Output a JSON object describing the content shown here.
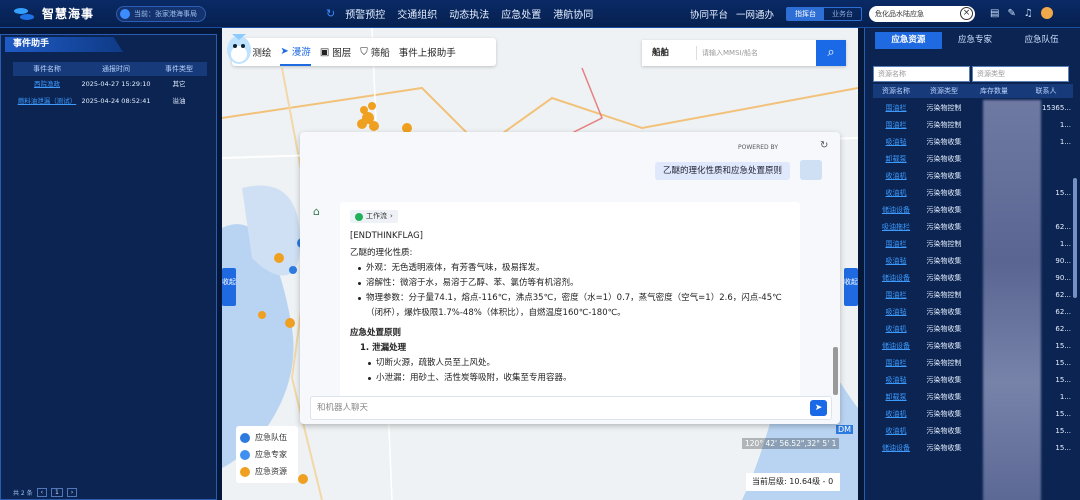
{
  "header": {
    "app_title": "智慧海事",
    "location": "当前：张家港海事局",
    "nav": [
      "预警预控",
      "交通组织",
      "动态执法",
      "应急处置",
      "港航协同"
    ],
    "collab": "协同平台",
    "portal": "一网通办",
    "seg_on": "指挥台",
    "seg_off": "业务台",
    "search_value": "危化品水陆应急"
  },
  "event_panel": {
    "title": "事件助手",
    "columns": [
      "事件名称",
      "通报时间",
      "事件类型"
    ],
    "rows": [
      {
        "name": "西院渔政",
        "time": "2025-04-27 15:29:10",
        "type": "其它"
      },
      {
        "name": "燃料油泄漏（测试）",
        "time": "2025-04-24 08:52:41",
        "type": "溢油"
      }
    ],
    "footer_total": "共 2 条",
    "page": "1"
  },
  "map": {
    "tools": [
      {
        "icon": "✂",
        "label": "测绘",
        "active": false
      },
      {
        "icon": "➤",
        "label": "漫游",
        "active": true
      },
      {
        "icon": "▣",
        "label": "图层",
        "active": false
      },
      {
        "icon": "⛉",
        "label": "筛船",
        "active": false
      },
      {
        "icon": "",
        "label": "事件上报助手",
        "active": false
      }
    ],
    "search_type": "船舶",
    "search_placeholder": "请输入MMSI/船名",
    "collapse_label": "收起",
    "legend": [
      {
        "label": "应急队伍",
        "color": "#2d7be0"
      },
      {
        "label": "应急专家",
        "color": "#3f8ff0"
      },
      {
        "label": "应急资源",
        "color": "#f0a020"
      }
    ],
    "coordinate": "120° 42' 56.52\",32° 5' 1",
    "zoom_level": "当前层级: 10.64级 - 0",
    "water_label": "DM"
  },
  "chat": {
    "powered_by": "POWERED BY",
    "user_message": "乙醚的理化性质和应急处置原则",
    "workflow_badge": "工作流",
    "think_flag": "[ENDTHINKFLAG]",
    "section1_title": "乙醚的理化性质:",
    "props": [
      "外观：无色透明液体，有芳香气味，极易挥发。",
      "溶解性：微溶于水，易溶于乙醇、苯、氯仿等有机溶剂。",
      "物理参数：分子量74.1，熔点-116℃，沸点35℃，密度（水=1）0.7，蒸气密度（空气=1）2.6，闪点-45℃（闭杯），爆炸极限1.7%-48%（体积比），自燃温度160℃-180℃。"
    ],
    "section2_title": "应急处置原则",
    "step1_title": "1. 泄漏处理",
    "step1_items": [
      "切断火源，疏散人员至上风处。",
      "小泄漏：用砂土、活性炭等吸附，收集至专用容器。"
    ],
    "input_placeholder": "和机器人聊天"
  },
  "resource_panel": {
    "tabs": [
      {
        "label": "应急资源",
        "active": true
      },
      {
        "label": "应急专家",
        "active": false
      },
      {
        "label": "应急队伍",
        "active": false
      }
    ],
    "filter_name": "资源名称",
    "filter_type": "资源类型",
    "columns": [
      "资源名称",
      "资源类型",
      "库存数量",
      "联系人"
    ],
    "rows": [
      {
        "name": "围油栏",
        "type": "污染物控制",
        "contact": "15365..."
      },
      {
        "name": "围油栏",
        "type": "污染物控制",
        "contact": "1..."
      },
      {
        "name": "吸油毡",
        "type": "污染物收集",
        "contact": "1..."
      },
      {
        "name": "卸载泵",
        "type": "污染物收集",
        "contact": ""
      },
      {
        "name": "收油机",
        "type": "污染物收集",
        "contact": ""
      },
      {
        "name": "收油机",
        "type": "污染物收集",
        "contact": "15..."
      },
      {
        "name": "储油设备",
        "type": "污染物收集",
        "contact": ""
      },
      {
        "name": "吸油拖栏",
        "type": "污染物收集",
        "contact": "62..."
      },
      {
        "name": "围油栏",
        "type": "污染物控制",
        "contact": "1..."
      },
      {
        "name": "吸油毡",
        "type": "污染物收集",
        "contact": "90..."
      },
      {
        "name": "储油设备",
        "type": "污染物收集",
        "contact": "90..."
      },
      {
        "name": "围油栏",
        "type": "污染物控制",
        "contact": "62..."
      },
      {
        "name": "吸油毡",
        "type": "污染物收集",
        "contact": "62..."
      },
      {
        "name": "收油机",
        "type": "污染物收集",
        "contact": "62..."
      },
      {
        "name": "储油设备",
        "type": "污染物收集",
        "contact": "15..."
      },
      {
        "name": "围油栏",
        "type": "污染物控制",
        "contact": "15..."
      },
      {
        "name": "吸油毡",
        "type": "污染物收集",
        "contact": "15..."
      },
      {
        "name": "卸载泵",
        "type": "污染物收集",
        "contact": "1..."
      },
      {
        "name": "收油机",
        "type": "污染物收集",
        "contact": "15..."
      },
      {
        "name": "收油机",
        "type": "污染物收集",
        "contact": "15..."
      },
      {
        "name": "储油设备",
        "type": "污染物收集",
        "contact": "15..."
      }
    ]
  }
}
